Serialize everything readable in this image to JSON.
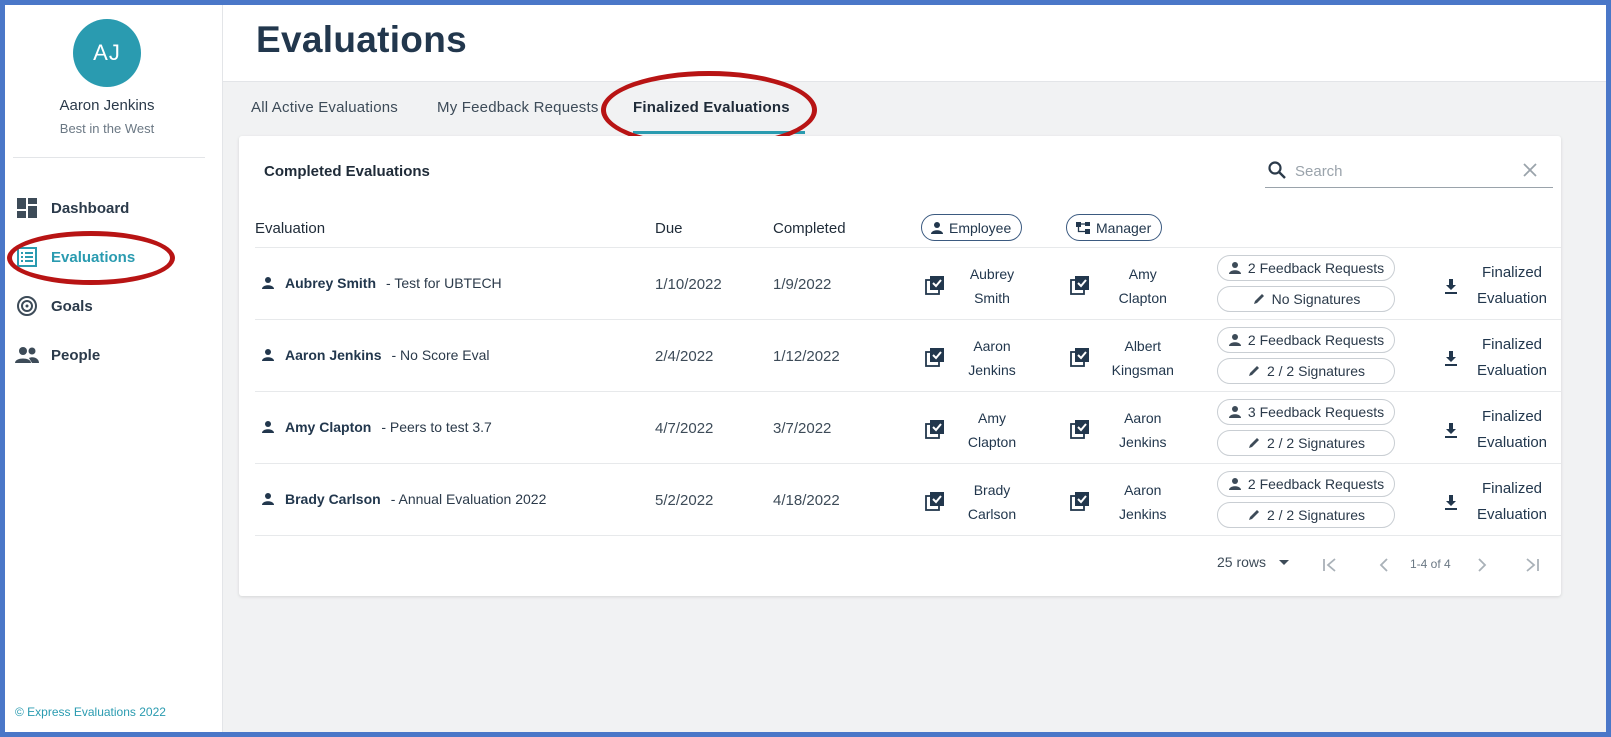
{
  "user": {
    "initials": "AJ",
    "name": "Aaron Jenkins",
    "subtitle": "Best in the West"
  },
  "sidebar": {
    "items": [
      {
        "label": "Dashboard",
        "icon": "dashboard-icon"
      },
      {
        "label": "Evaluations",
        "icon": "list-icon",
        "active": true
      },
      {
        "label": "Goals",
        "icon": "target-icon"
      },
      {
        "label": "People",
        "icon": "people-icon"
      }
    ],
    "footer": "© Express Evaluations 2022"
  },
  "header": {
    "title": "Evaluations"
  },
  "tabs": [
    {
      "label": "All Active Evaluations"
    },
    {
      "label": "My Feedback Requests"
    },
    {
      "label": "Finalized Evaluations",
      "active": true
    }
  ],
  "card": {
    "title": "Completed Evaluations",
    "search_placeholder": "Search"
  },
  "table": {
    "headers": {
      "evaluation": "Evaluation",
      "due": "Due",
      "completed": "Completed",
      "employee": "Employee",
      "manager": "Manager"
    },
    "rows": [
      {
        "employee": "Aubrey Smith",
        "eval": "- Test for UBTECH",
        "due": "1/10/2022",
        "completed": "1/9/2022",
        "emp_first": "Aubrey",
        "emp_last": "Smith",
        "mgr_first": "Amy",
        "mgr_last": "Clapton",
        "feedback": "2 Feedback Requests",
        "signatures": "No Signatures",
        "final_1": "Finalized",
        "final_2": "Evaluation"
      },
      {
        "employee": "Aaron Jenkins",
        "eval": "- No Score Eval",
        "due": "2/4/2022",
        "completed": "1/12/2022",
        "emp_first": "Aaron",
        "emp_last": "Jenkins",
        "mgr_first": "Albert",
        "mgr_last": "Kingsman",
        "feedback": "2 Feedback Requests",
        "signatures": "2 / 2 Signatures",
        "final_1": "Finalized",
        "final_2": "Evaluation"
      },
      {
        "employee": "Amy Clapton",
        "eval": "- Peers to test 3.7",
        "due": "4/7/2022",
        "completed": "3/7/2022",
        "emp_first": "Amy",
        "emp_last": "Clapton",
        "mgr_first": "Aaron",
        "mgr_last": "Jenkins",
        "feedback": "3 Feedback Requests",
        "signatures": "2 / 2 Signatures",
        "final_1": "Finalized",
        "final_2": "Evaluation"
      },
      {
        "employee": "Brady Carlson",
        "eval": "- Annual Evaluation 2022",
        "due": "5/2/2022",
        "completed": "4/18/2022",
        "emp_first": "Brady",
        "emp_last": "Carlson",
        "mgr_first": "Aaron",
        "mgr_last": "Jenkins",
        "feedback": "2 Feedback Requests",
        "signatures": "2 / 2 Signatures",
        "final_1": "Finalized",
        "final_2": "Evaluation"
      }
    ]
  },
  "pagination": {
    "rows": "25 rows",
    "range": "1-4 of 4"
  },
  "colors": {
    "accent": "#2a9bb0",
    "frame": "#4a77c8",
    "highlight": "#b81414",
    "title": "#22374d"
  }
}
